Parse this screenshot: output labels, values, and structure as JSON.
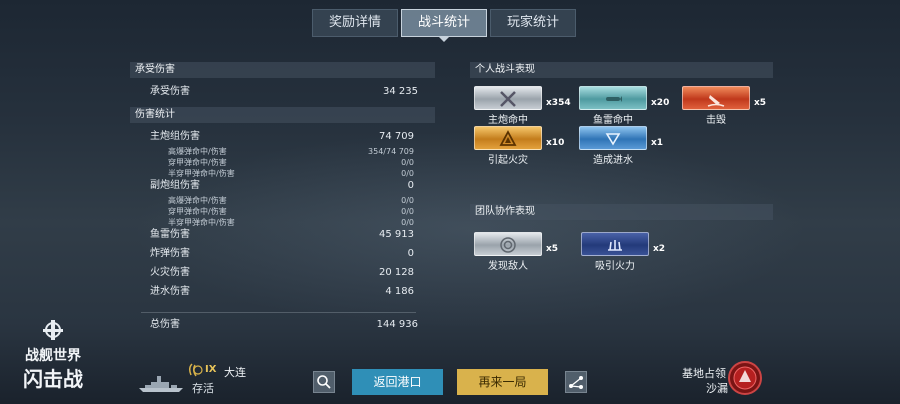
{
  "tabs": [
    "奖励详情",
    "战斗统计",
    "玩家统计"
  ],
  "left": {
    "received_header": "承受伤害",
    "received_label": "承受伤害",
    "received_value": "34 235",
    "stats_header": "伤害统计",
    "rows": [
      {
        "label": "主炮组伤害",
        "value": "74 709",
        "sub": false
      },
      {
        "label": "高爆弹命中/伤害",
        "value": "354/74 709",
        "sub": true
      },
      {
        "label": "穿甲弹命中/伤害",
        "value": "0/0",
        "sub": true
      },
      {
        "label": "半穿甲弹命中/伤害",
        "value": "0/0",
        "sub": true
      },
      {
        "label": "副炮组伤害",
        "value": "0",
        "sub": false
      },
      {
        "label": "高爆弹命中/伤害",
        "value": "0/0",
        "sub": true
      },
      {
        "label": "穿甲弹命中/伤害",
        "value": "0/0",
        "sub": true
      },
      {
        "label": "半穿甲弹命中/伤害",
        "value": "0/0",
        "sub": true
      },
      {
        "label": "鱼雷伤害",
        "value": "45 913",
        "sub": false
      },
      {
        "label": "炸弹伤害",
        "value": "0",
        "sub": false
      },
      {
        "label": "火灾伤害",
        "value": "20 128",
        "sub": false
      },
      {
        "label": "进水伤害",
        "value": "4 186",
        "sub": false
      }
    ],
    "total_label": "总伤害",
    "total_value": "144 936"
  },
  "right": {
    "personal_header": "个人战斗表现",
    "personal": [
      {
        "label": "主炮命中",
        "count": "x354",
        "color": "silver",
        "icon": "crossed-guns-icon"
      },
      {
        "label": "鱼雷命中",
        "count": "x20",
        "color": "teal",
        "icon": "torpedo-icon"
      },
      {
        "label": "击毁",
        "count": "x5",
        "color": "red",
        "icon": "sinking-ship-icon"
      },
      {
        "label": "引起火灾",
        "count": "x10",
        "color": "gold",
        "icon": "fire-icon"
      },
      {
        "label": "造成进水",
        "count": "x1",
        "color": "blue",
        "icon": "flooding-icon"
      }
    ],
    "team_header": "团队协作表现",
    "team": [
      {
        "label": "发现敌人",
        "count": "x5",
        "color": "silver",
        "icon": "spotting-icon"
      },
      {
        "label": "吸引火力",
        "count": "x2",
        "color": "navy",
        "icon": "tanking-icon"
      }
    ]
  },
  "bottom": {
    "ship_tier": "IX",
    "ship_name": "大连",
    "ship_status": "存活",
    "return_label": "返回港口",
    "again_label": "再来一局",
    "mode_label": "基地占领",
    "map_label": "沙漏",
    "logo_line1": "战舰世界",
    "logo_line2": "闪击战"
  }
}
